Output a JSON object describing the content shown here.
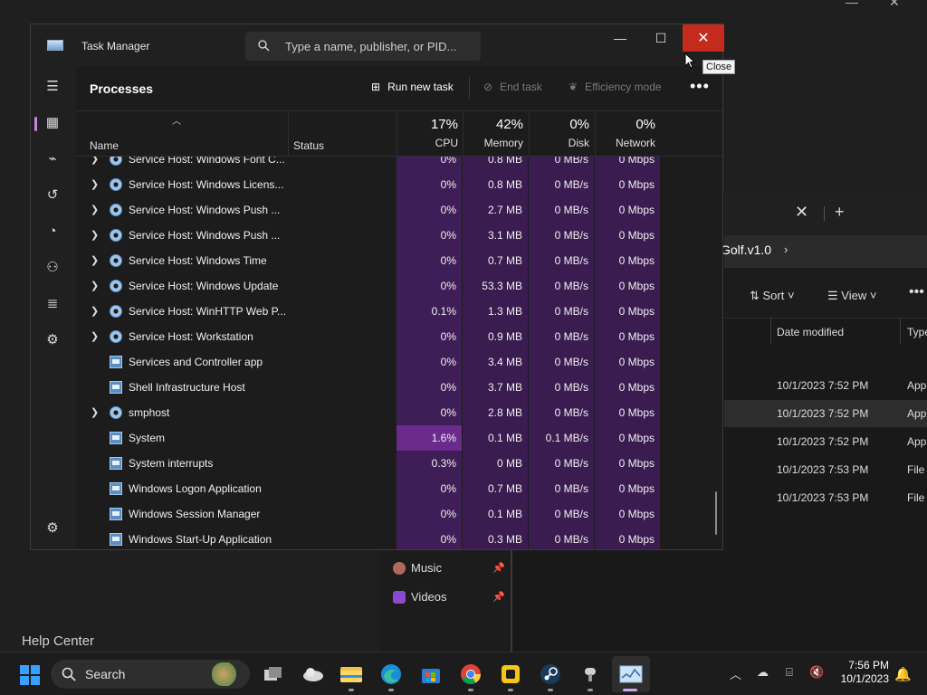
{
  "desktop": {
    "help_center": "Help Center"
  },
  "explorer": {
    "tab_close": "✕",
    "tab_add": "+",
    "breadcrumb": "Golf.v1.0",
    "toolbar": {
      "sort": "Sort",
      "view": "View"
    },
    "columns": {
      "date_modified": "Date modified",
      "type": "Type"
    },
    "rows": [
      {
        "date": "10/1/2023 7:52 PM",
        "type": "App"
      },
      {
        "date": "10/1/2023 7:52 PM",
        "type": "App"
      },
      {
        "date": "10/1/2023 7:52 PM",
        "type": "App"
      },
      {
        "date": "10/1/2023 7:53 PM",
        "type": "File"
      },
      {
        "date": "10/1/2023 7:53 PM",
        "type": "File"
      }
    ],
    "nav": [
      {
        "label": "Music",
        "icon": "music-icon",
        "color": "#b06a5a"
      },
      {
        "label": "Videos",
        "icon": "videos-icon",
        "color": "#8a4ad0"
      }
    ]
  },
  "task_manager": {
    "title": "Task Manager",
    "search_placeholder": "Type a name, publisher, or PID...",
    "close_tooltip": "Close",
    "heading": "Processes",
    "commands": {
      "run_new_task": "Run new task",
      "end_task": "End task",
      "efficiency_mode": "Efficiency mode"
    },
    "columns": {
      "name": "Name",
      "status": "Status",
      "cpu": {
        "pct": "17%",
        "label": "CPU"
      },
      "memory": {
        "pct": "42%",
        "label": "Memory"
      },
      "disk": {
        "pct": "0%",
        "label": "Disk"
      },
      "network": {
        "pct": "0%",
        "label": "Network"
      }
    },
    "processes": [
      {
        "name": "Service Host: Windows Font C...",
        "icon": "gear",
        "expand": true,
        "cpu": "0%",
        "mem": "0.8 MB",
        "disk": "0 MB/s",
        "net": "0 Mbps"
      },
      {
        "name": "Service Host: Windows Licens...",
        "icon": "gear",
        "expand": true,
        "cpu": "0%",
        "mem": "0.8 MB",
        "disk": "0 MB/s",
        "net": "0 Mbps"
      },
      {
        "name": "Service Host: Windows Push ...",
        "icon": "gear",
        "expand": true,
        "cpu": "0%",
        "mem": "2.7 MB",
        "disk": "0 MB/s",
        "net": "0 Mbps"
      },
      {
        "name": "Service Host: Windows Push ...",
        "icon": "gear",
        "expand": true,
        "cpu": "0%",
        "mem": "3.1 MB",
        "disk": "0 MB/s",
        "net": "0 Mbps"
      },
      {
        "name": "Service Host: Windows Time",
        "icon": "gear",
        "expand": true,
        "cpu": "0%",
        "mem": "0.7 MB",
        "disk": "0 MB/s",
        "net": "0 Mbps"
      },
      {
        "name": "Service Host: Windows Update",
        "icon": "gear",
        "expand": true,
        "cpu": "0%",
        "mem": "53.3 MB",
        "disk": "0 MB/s",
        "net": "0 Mbps"
      },
      {
        "name": "Service Host: WinHTTP Web P...",
        "icon": "gear",
        "expand": true,
        "cpu": "0.1%",
        "mem": "1.3 MB",
        "disk": "0 MB/s",
        "net": "0 Mbps"
      },
      {
        "name": "Service Host: Workstation",
        "icon": "gear",
        "expand": true,
        "cpu": "0%",
        "mem": "0.9 MB",
        "disk": "0 MB/s",
        "net": "0 Mbps"
      },
      {
        "name": "Services and Controller app",
        "icon": "window",
        "expand": false,
        "cpu": "0%",
        "mem": "3.4 MB",
        "disk": "0 MB/s",
        "net": "0 Mbps"
      },
      {
        "name": "Shell Infrastructure Host",
        "icon": "window",
        "expand": false,
        "cpu": "0%",
        "mem": "3.7 MB",
        "disk": "0 MB/s",
        "net": "0 Mbps"
      },
      {
        "name": "smphost",
        "icon": "gear",
        "expand": true,
        "cpu": "0%",
        "mem": "2.8 MB",
        "disk": "0 MB/s",
        "net": "0 Mbps"
      },
      {
        "name": "System",
        "icon": "window",
        "expand": false,
        "cpu": "1.6%",
        "mem": "0.1 MB",
        "disk": "0.1 MB/s",
        "net": "0 Mbps",
        "hot": true
      },
      {
        "name": "System interrupts",
        "icon": "window",
        "expand": false,
        "cpu": "0.3%",
        "mem": "0 MB",
        "disk": "0 MB/s",
        "net": "0 Mbps"
      },
      {
        "name": "Windows Logon Application",
        "icon": "window",
        "expand": false,
        "cpu": "0%",
        "mem": "0.7 MB",
        "disk": "0 MB/s",
        "net": "0 Mbps"
      },
      {
        "name": "Windows Session Manager",
        "icon": "window",
        "expand": false,
        "cpu": "0%",
        "mem": "0.1 MB",
        "disk": "0 MB/s",
        "net": "0 Mbps"
      },
      {
        "name": "Windows Start-Up Application",
        "icon": "window",
        "expand": false,
        "cpu": "0%",
        "mem": "0.3 MB",
        "disk": "0 MB/s",
        "net": "0 Mbps"
      }
    ]
  },
  "taskbar": {
    "search_label": "Search",
    "time": "7:56 PM",
    "date": "10/1/2023",
    "apps": [
      "task-view-icon",
      "weather-icon",
      "file-explorer-icon",
      "edge-icon",
      "store-icon",
      "chrome-icon",
      "app-yellow-icon",
      "steam-icon",
      "app-gray-icon",
      "task-manager-icon"
    ],
    "accent": "#c8a6f0"
  }
}
